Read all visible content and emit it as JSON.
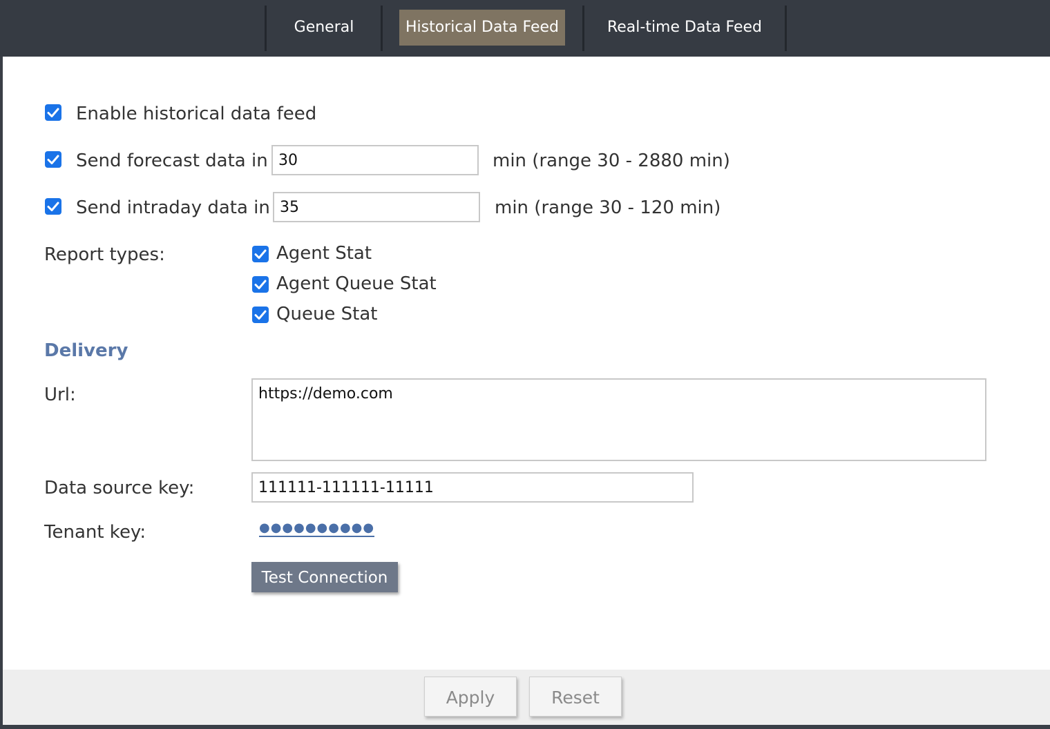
{
  "tabs": [
    {
      "label": "General",
      "active": false
    },
    {
      "label": "Historical Data Feed",
      "active": true
    },
    {
      "label": "Real-time Data Feed",
      "active": false
    }
  ],
  "enable_feed": {
    "label": "Enable historical data feed",
    "checked": true
  },
  "forecast": {
    "label": "Send forecast data in",
    "value": "30",
    "range": "min (range 30 - 2880 min)",
    "checked": true
  },
  "intraday": {
    "label": "Send intraday data in",
    "value": "35",
    "range": "min (range 30 - 120 min)",
    "checked": true
  },
  "report_types": {
    "label": "Report types:",
    "options": [
      {
        "label": "Agent Stat",
        "checked": true
      },
      {
        "label": "Agent Queue Stat",
        "checked": true
      },
      {
        "label": "Queue Stat",
        "checked": true
      }
    ]
  },
  "delivery": {
    "title": "Delivery",
    "url_label": "Url:",
    "url_value": "https://demo.com",
    "data_source_key_label": "Data source key:",
    "data_source_key_value": "111111-111111-11111",
    "tenant_key_label": "Tenant key:",
    "tenant_key_value": "●●●●●●●●●●",
    "test_connection": "Test Connection"
  },
  "footer": {
    "apply": "Apply",
    "reset": "Reset"
  },
  "colors": {
    "tabbar": "#363b43",
    "active_tab": "#7f7462",
    "checkbox": "#1a73e8",
    "section_title": "#5a78a8",
    "test_button": "#6e7889"
  }
}
